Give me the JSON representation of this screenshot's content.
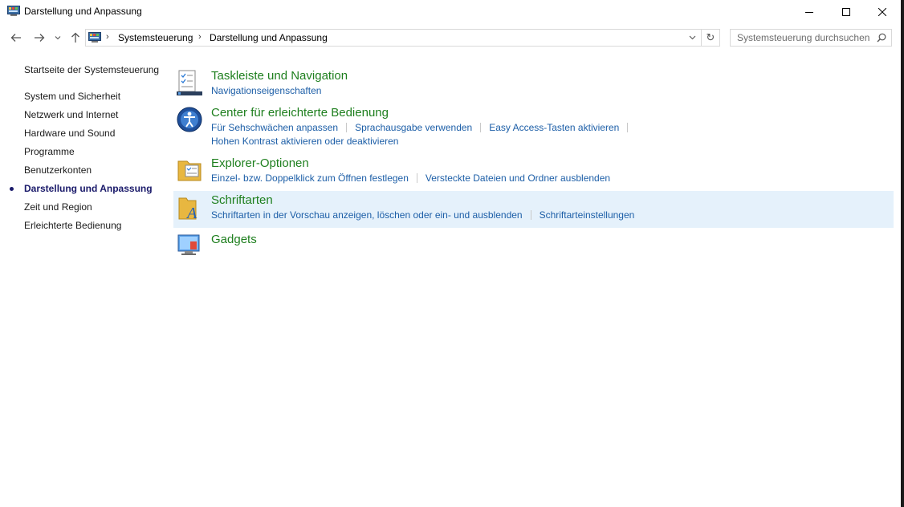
{
  "window": {
    "title": "Darstellung und Anpassung"
  },
  "address": {
    "crumbs": [
      "Systemsteuerung",
      "Darstellung und Anpassung"
    ],
    "search_placeholder": "Systemsteuerung durchsuchen"
  },
  "sidebar": {
    "home": "Startseite der Systemsteuerung",
    "items": [
      {
        "label": "System und Sicherheit"
      },
      {
        "label": "Netzwerk und Internet"
      },
      {
        "label": "Hardware und Sound"
      },
      {
        "label": "Programme"
      },
      {
        "label": "Benutzerkonten"
      },
      {
        "label": "Darstellung und Anpassung",
        "current": true
      },
      {
        "label": "Zeit und Region"
      },
      {
        "label": "Erleichterte Bedienung"
      }
    ]
  },
  "categories": [
    {
      "title": "Taskleiste und Navigation",
      "icon": "taskbar-icon",
      "links": [
        "Navigationseigenschaften"
      ]
    },
    {
      "title": "Center für erleichterte Bedienung",
      "icon": "ease-of-access-icon",
      "links": [
        "Für Sehschwächen anpassen",
        "Sprachausgabe verwenden",
        "Easy Access-Tasten aktivieren",
        "Hohen Kontrast aktivieren oder deaktivieren"
      ]
    },
    {
      "title": "Explorer-Optionen",
      "icon": "folder-options-icon",
      "links": [
        "Einzel- bzw. Doppelklick zum Öffnen festlegen",
        "Versteckte Dateien und Ordner ausblenden"
      ]
    },
    {
      "title": "Schriftarten",
      "icon": "fonts-icon",
      "links": [
        "Schriftarten in der Vorschau anzeigen, löschen oder ein- und ausblenden",
        "Schriftarteinstellungen"
      ],
      "highlighted": true
    },
    {
      "title": "Gadgets",
      "icon": "gadgets-icon",
      "links": []
    }
  ],
  "colors": {
    "category_title": "#1e7f1e",
    "link": "#1c5ea7",
    "highlight": "#e5f1fb"
  }
}
